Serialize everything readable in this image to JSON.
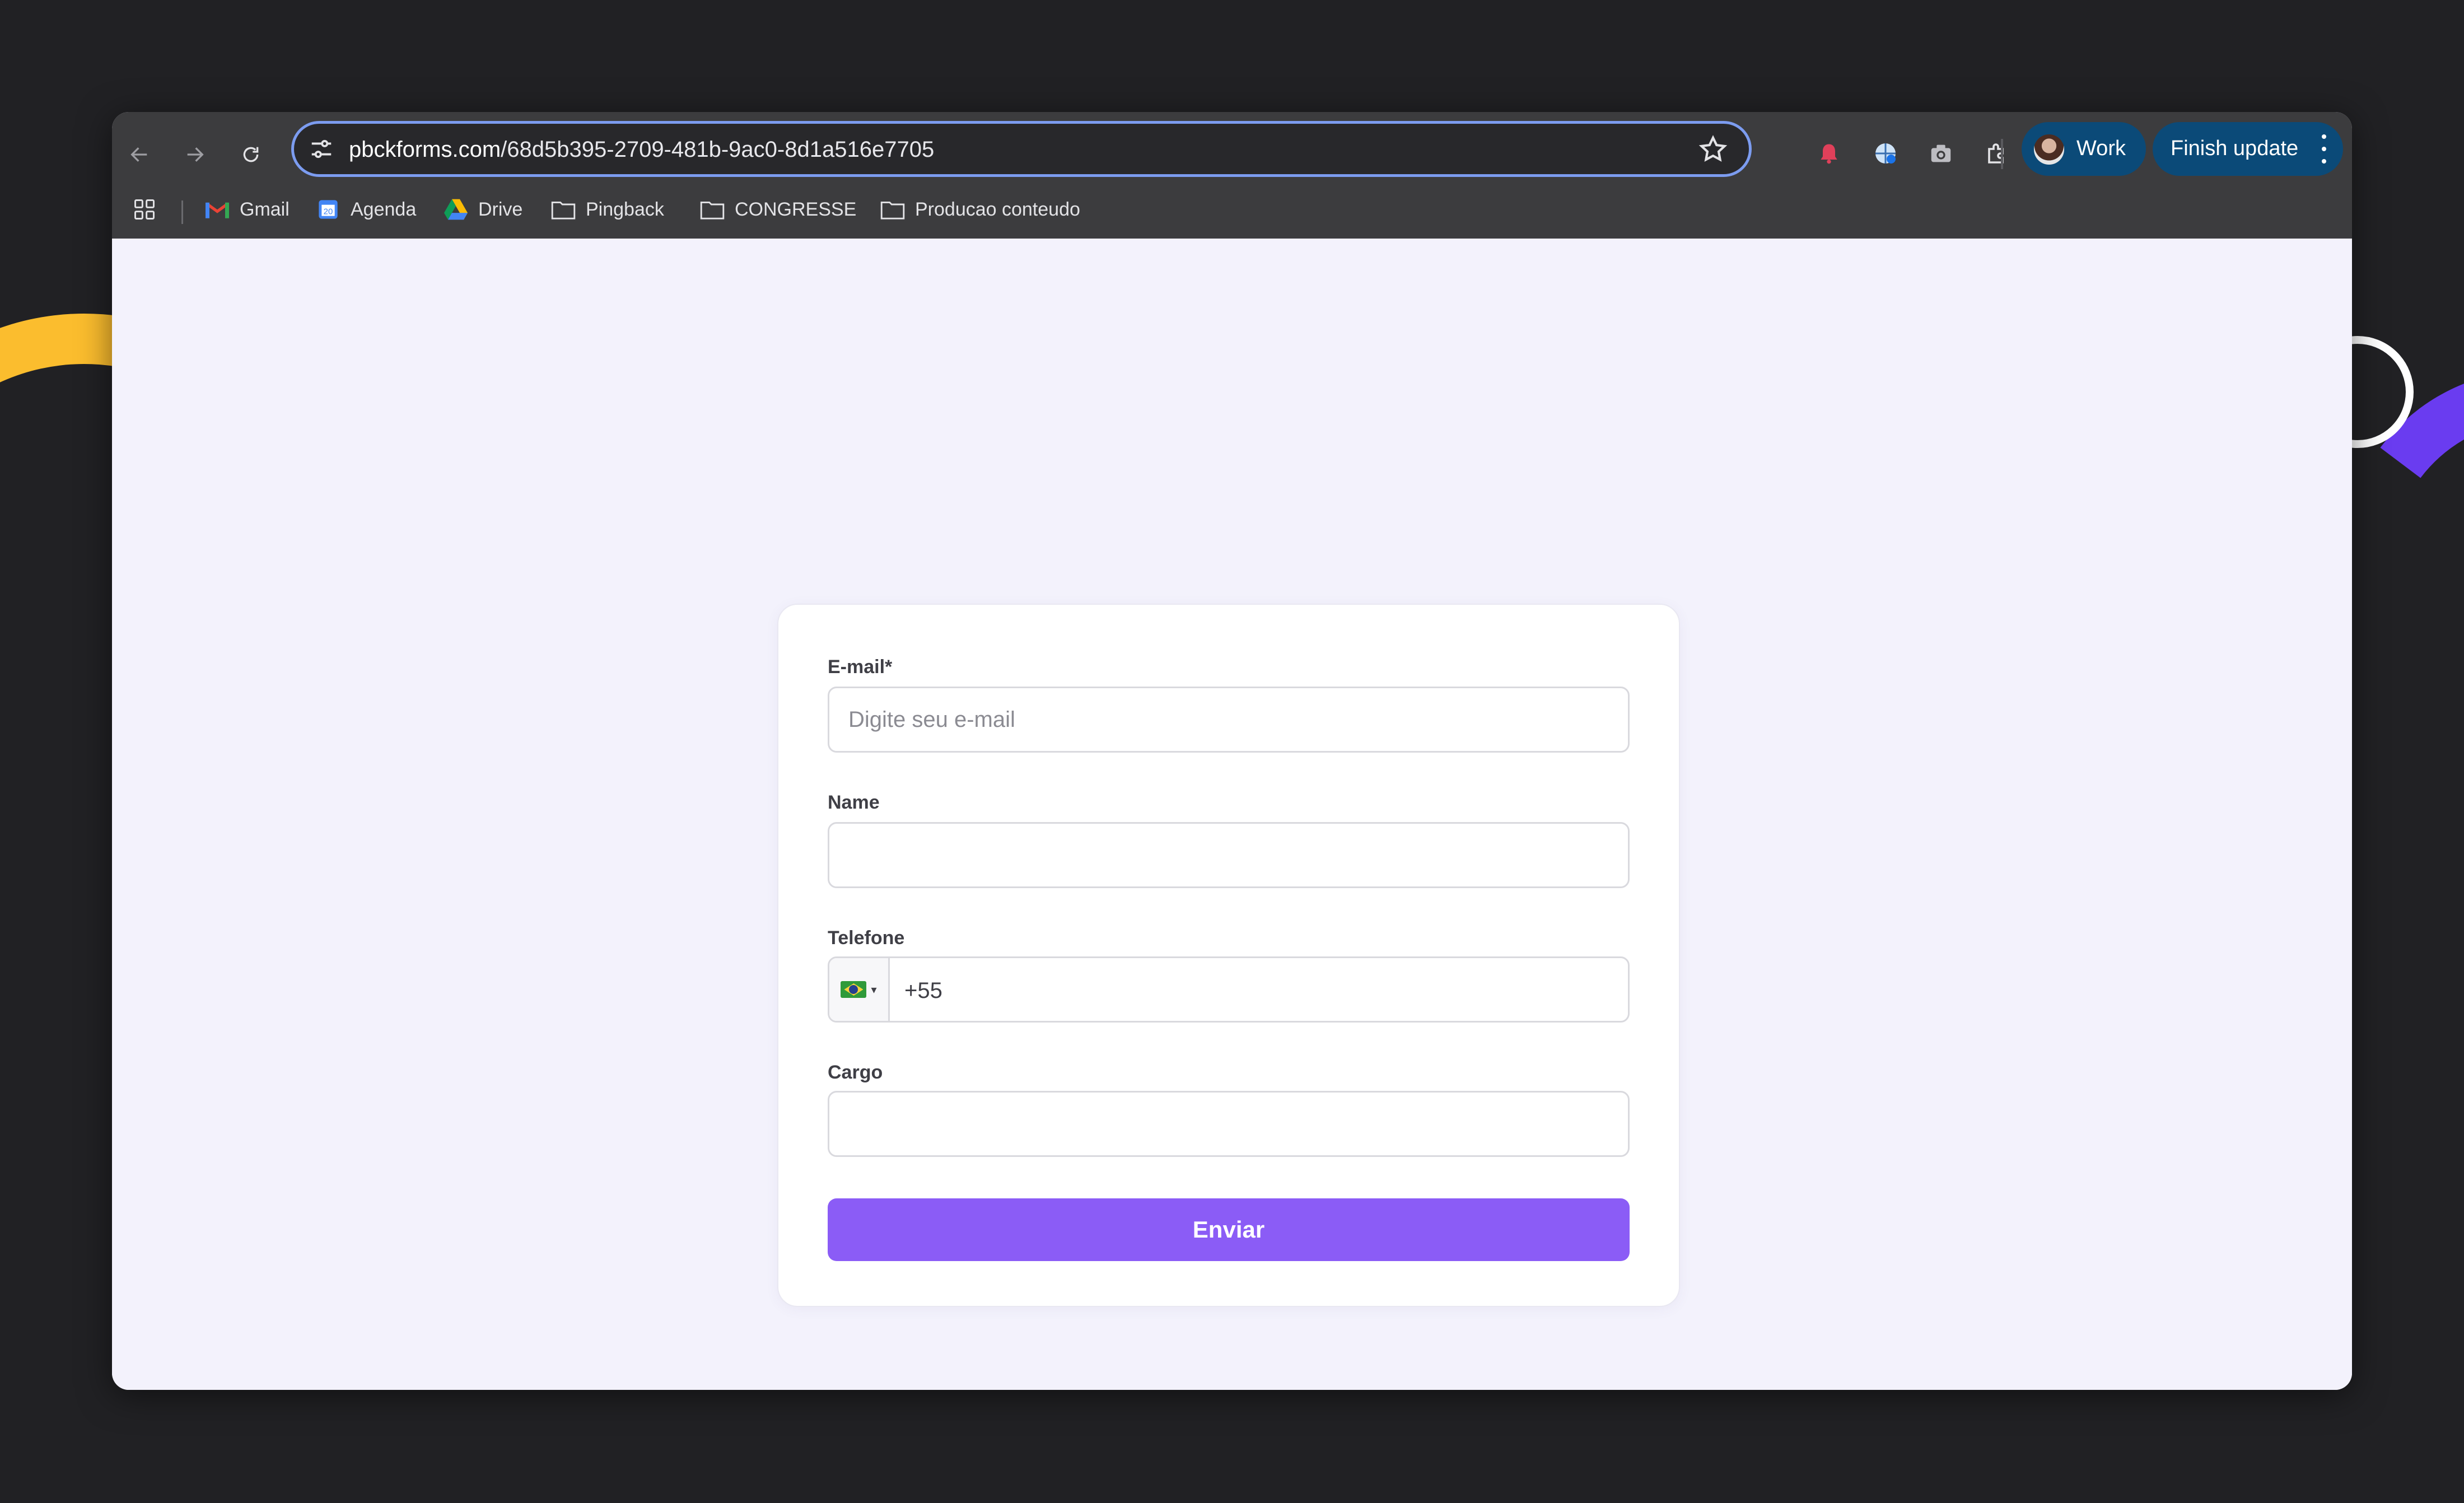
{
  "browser": {
    "url_host": "pbckforms.com",
    "url_path": "/68d5b395-2709-481b-9ac0-8d1a516e7705",
    "profile_label": "Work",
    "update_label": "Finish update"
  },
  "bookmarks": [
    {
      "label": "Gmail",
      "icon": "gmail-icon"
    },
    {
      "label": "Agenda",
      "icon": "calendar-icon"
    },
    {
      "label": "Drive",
      "icon": "drive-icon"
    },
    {
      "label": "Pingback",
      "icon": "folder-icon"
    },
    {
      "label": "CONGRESSE",
      "icon": "folder-icon"
    },
    {
      "label": "Producao conteudo",
      "icon": "folder-icon"
    }
  ],
  "form": {
    "email": {
      "label": "E-mail*",
      "placeholder": "Digite seu e-mail",
      "value": ""
    },
    "name": {
      "label": "Name",
      "value": ""
    },
    "phone": {
      "label": "Telefone",
      "country": "BR",
      "value": "+55"
    },
    "cargo": {
      "label": "Cargo",
      "value": ""
    },
    "submit_label": "Enviar"
  },
  "colors": {
    "accent": "#8b5cf6",
    "omnibox_focus": "#7c9cf0",
    "chip_bg": "#0b4a78",
    "page_bg": "#f3f2fc"
  }
}
